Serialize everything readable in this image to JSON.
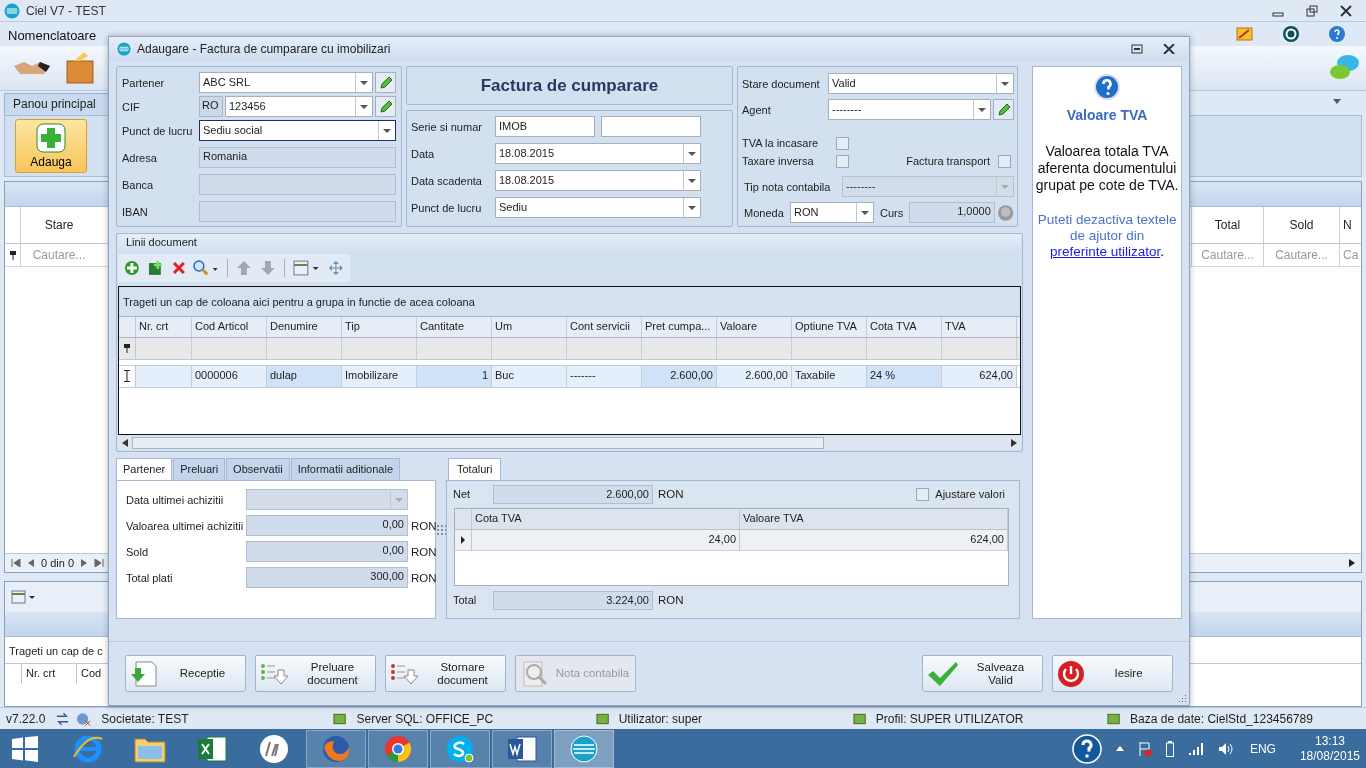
{
  "app": {
    "title": "Ciel V7 - TEST",
    "menu": [
      {
        "label": "Nomenclatoare"
      }
    ]
  },
  "main": {
    "tab": "Panou principal",
    "add_button": "Adauga",
    "list_left": {
      "columns": [
        "Stare"
      ],
      "filter": "Cautare..."
    },
    "list_right": {
      "columns": [
        "Total",
        "Sold",
        "N"
      ],
      "filters": [
        "Cautare...",
        "Cautare...",
        "Ca"
      ]
    },
    "pager": "0 din 0",
    "lower": {
      "group_hint": "Trageti un cap de c",
      "columns": [
        "Nr. crt",
        "Cod"
      ]
    }
  },
  "dialog": {
    "title": "Adaugare - Factura de cumparare cu imobilizari",
    "partner_fields": [
      {
        "label": "Partener",
        "value": "ABC SRL",
        "kind": "combo-edit"
      },
      {
        "label": "CIF",
        "prefix": "RO",
        "value": "123456",
        "kind": "combo-edit"
      },
      {
        "label": "Punct de lucru",
        "value": "Sediu social",
        "kind": "combo",
        "focused": true
      },
      {
        "label": "Adresa",
        "value": "Romania",
        "kind": "readonly"
      },
      {
        "label": "Banca",
        "kind": "readonly"
      },
      {
        "label": "IBAN",
        "kind": "readonly"
      }
    ],
    "heading": "Factura de cumparare",
    "doc_fields": [
      {
        "label": "Serie si numar",
        "value": "IMOB",
        "kind": "pair"
      },
      {
        "label": "Data",
        "value": "18.08.2015",
        "kind": "combo"
      },
      {
        "label": "Data scadenta",
        "value": "18.08.2015",
        "kind": "combo"
      },
      {
        "label": "Punct de lucru",
        "value": "Sediu",
        "kind": "combo"
      }
    ],
    "state": {
      "status": {
        "label": "Stare document",
        "value": "Valid"
      },
      "agent": {
        "label": "Agent",
        "value": "--------"
      },
      "checks": [
        {
          "label": "TVA la incasare",
          "checked": false
        },
        {
          "label": "Taxare inversa",
          "checked": false
        },
        {
          "label": "Factura transport",
          "checked": false
        }
      ],
      "note_type": {
        "label": "Tip nota contabila",
        "value": "--------",
        "disabled": true
      },
      "currency": {
        "label": "Moneda",
        "value": "RON"
      },
      "rate": {
        "label": "Curs",
        "value": "1,0000"
      }
    },
    "help": {
      "title": "Valoare TVA",
      "text": "Valoarea totala TVA aferenta documentului grupat pe cote de TVA.",
      "hint": "Puteti dezactiva textele de ajutor din",
      "link": "preferinte utilizator",
      "hint_end": "."
    },
    "lines": {
      "title": "Linii document",
      "group_hint": "Trageti un cap de coloana aici pentru a grupa in functie de acea coloana",
      "columns": [
        {
          "label": "Nr. crt"
        },
        {
          "label": "Cod Articol"
        },
        {
          "label": "Denumire"
        },
        {
          "label": "Tip"
        },
        {
          "label": "Cantitate"
        },
        {
          "label": "Um"
        },
        {
          "label": "Cont servicii"
        },
        {
          "label": "Pret cumpa..."
        },
        {
          "label": "Valoare"
        },
        {
          "label": "Optiune TVA"
        },
        {
          "label": "Cota TVA"
        },
        {
          "label": "TVA"
        }
      ],
      "rows": [
        {
          "selected": true,
          "cells": [
            null,
            "0000006",
            "dulap",
            "Imobilizare",
            "1",
            "Buc",
            "-------",
            "2.600,00",
            "2.600,00",
            "Taxabile",
            "24 %",
            "624,00"
          ]
        }
      ]
    },
    "tabs": [
      {
        "label": "Partener",
        "selected": true
      },
      {
        "label": "Preluari",
        "selected": false
      },
      {
        "label": "Observatii",
        "selected": false
      },
      {
        "label": "Informatii aditionale",
        "selected": false
      }
    ],
    "partner_info": [
      {
        "label": "Data ultimei achizitii",
        "kind": "date"
      },
      {
        "label": "Valoarea ultimei achizitii",
        "value": "0,00",
        "currency": "RON",
        "kind": "amount"
      },
      {
        "label": "Sold",
        "value": "0,00",
        "currency": "RON",
        "kind": "amount"
      },
      {
        "label": "Total plati",
        "value": "300,00",
        "currency": "RON",
        "kind": "amount"
      }
    ],
    "totals": {
      "tab": "Totaluri",
      "net_label": "Net",
      "net": "2.600,00",
      "net_currency": "RON",
      "adjust": {
        "label": "Ajustare valori",
        "checked": false
      },
      "columns": [
        "Cota TVA",
        "Valoare TVA"
      ],
      "rows": [
        [
          "24,00",
          "624,00"
        ]
      ],
      "total_label": "Total",
      "total": "3.224,00",
      "total_currency": "RON"
    },
    "buttons": [
      {
        "kind": "receptie",
        "label": "Receptie",
        "disabled": false
      },
      {
        "kind": "preluare",
        "label": "Preluare document",
        "disabled": false
      },
      {
        "kind": "stornare",
        "label": "Stornare document",
        "disabled": false
      },
      {
        "kind": "nota",
        "label": "Nota contabila",
        "disabled": true
      },
      {
        "kind": "salveaza",
        "label": "Salveaza Valid",
        "disabled": false
      },
      {
        "kind": "iesire",
        "label": "Iesire",
        "disabled": false
      }
    ]
  },
  "status_bar": {
    "version": "v7.22.0",
    "items": [
      "Societate: TEST",
      "Server SQL: OFFICE_PC",
      "Utilizator: super",
      "Profil: SUPER UTILIZATOR",
      "Baza de date: CielStd_123456789"
    ]
  },
  "taskbar": {
    "apps": [
      {
        "kind": "ie",
        "running": false,
        "selected": false
      },
      {
        "kind": "explorer",
        "running": false,
        "selected": false
      },
      {
        "kind": "excel",
        "running": false,
        "selected": false
      },
      {
        "kind": "hp",
        "running": false,
        "selected": false
      },
      {
        "kind": "firefox",
        "running": true,
        "selected": false
      },
      {
        "kind": "chrome",
        "running": true,
        "selected": false
      },
      {
        "kind": "skype",
        "running": true,
        "selected": false
      },
      {
        "kind": "word",
        "running": true,
        "selected": false
      },
      {
        "kind": "ciel",
        "running": true,
        "selected": true
      }
    ],
    "language": "ENG",
    "time": "13:13",
    "date": "18/08/2015"
  }
}
